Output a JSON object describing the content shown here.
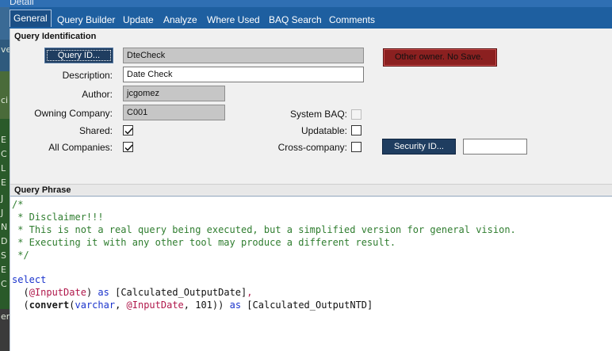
{
  "window": {
    "title": "Detail"
  },
  "left_strip_chars": [
    "ve",
    "ci",
    "E",
    "C",
    "L",
    "E",
    "J",
    "J",
    "N",
    "D",
    "S",
    "E",
    "C",
    "er"
  ],
  "tabs": [
    {
      "label": "General",
      "active": true
    },
    {
      "label": "Query Builder"
    },
    {
      "label": "Update"
    },
    {
      "label": "Analyze"
    },
    {
      "label": "Where Used"
    },
    {
      "label": "BAQ Search"
    },
    {
      "label": "Comments"
    }
  ],
  "identification": {
    "group_title": "Query Identification",
    "query_id_button": "Query ID...",
    "query_id_value": "DteCheck",
    "owner_warning": "Other owner. No Save.",
    "description_label": "Description:",
    "description_value": "Date Check",
    "author_label": "Author:",
    "author_value": "jcgomez",
    "owning_company_label": "Owning Company:",
    "owning_company_value": "C001",
    "system_baq_label": "System BAQ:",
    "system_baq_checked": false,
    "shared_label": "Shared:",
    "shared_checked": true,
    "updatable_label": "Updatable:",
    "updatable_checked": false,
    "all_companies_label": "All Companies:",
    "all_companies_checked": true,
    "cross_company_label": "Cross-company:",
    "cross_company_checked": false,
    "security_id_button": "Security ID...",
    "security_id_value": ""
  },
  "phrase": {
    "group_title": "Query Phrase",
    "l1": "/*",
    "l2": " * Disclaimer!!!",
    "l3": " * This is not a real query being executed, but a simplified version for general vision.",
    "l4": " * Executing it with any other tool may produce a different result.",
    "l5": " */",
    "kw_select": "select",
    "l7_open": "  (",
    "l7_var": "@InputDate",
    "l7_close": ")",
    "kw_as": "as",
    "l7_alias": "[Calculated_OutputDate]",
    "l7_comma": ",",
    "l8_open": "  (",
    "fn_convert": "convert",
    "l8_paren": "(",
    "kw_varchar": "varchar",
    "l8_sep1": ", ",
    "l8_var": "@InputDate",
    "l8_sep2": ", ",
    "l8_num": "101",
    "l8_close": "))",
    "l8_alias": "[Calculated_OutputNTD]"
  },
  "colors": {
    "tab_bar": "#1e5fa0",
    "warning": "#8b2020",
    "button_dark": "#1f3d60",
    "comment": "#2f7d2f",
    "keyword": "#1a33cc",
    "variable": "#b0184b"
  }
}
